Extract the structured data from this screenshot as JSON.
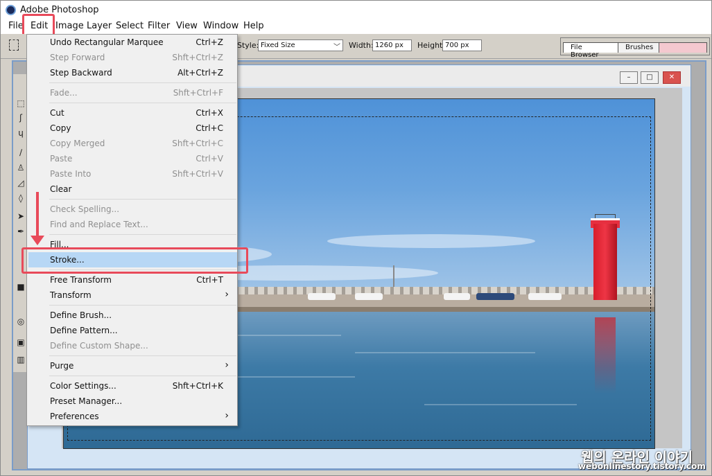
{
  "app": {
    "title": "Adobe Photoshop"
  },
  "menubar": [
    "File",
    "Edit",
    "Image",
    "Layer",
    "Select",
    "Filter",
    "View",
    "Window",
    "Help"
  ],
  "options": {
    "style_label": "Style:",
    "style_value": "Fixed Size",
    "width_label": "Width:",
    "width_value": "1260 px",
    "height_label": "Height:",
    "height_value": "700 px"
  },
  "palette_tabs": [
    "File Browser",
    "Brushes"
  ],
  "edit_menu": [
    {
      "label": "Undo Rectangular Marquee",
      "shortcut": "Ctrl+Z",
      "enabled": true
    },
    {
      "label": "Step Forward",
      "shortcut": "Shft+Ctrl+Z",
      "enabled": false
    },
    {
      "label": "Step Backward",
      "shortcut": "Alt+Ctrl+Z",
      "enabled": true
    },
    {
      "label": "Fade...",
      "shortcut": "Shft+Ctrl+F",
      "enabled": false
    },
    {
      "label": "Cut",
      "shortcut": "Ctrl+X",
      "enabled": true
    },
    {
      "label": "Copy",
      "shortcut": "Ctrl+C",
      "enabled": true
    },
    {
      "label": "Copy Merged",
      "shortcut": "Shft+Ctrl+C",
      "enabled": false
    },
    {
      "label": "Paste",
      "shortcut": "Ctrl+V",
      "enabled": false
    },
    {
      "label": "Paste Into",
      "shortcut": "Shft+Ctrl+V",
      "enabled": false
    },
    {
      "label": "Clear",
      "shortcut": "",
      "enabled": true
    },
    {
      "label": "Check Spelling...",
      "shortcut": "",
      "enabled": false
    },
    {
      "label": "Find and Replace Text...",
      "shortcut": "",
      "enabled": false
    },
    {
      "label": "Fill...",
      "shortcut": "",
      "enabled": true
    },
    {
      "label": "Stroke...",
      "shortcut": "",
      "enabled": true
    },
    {
      "label": "Free Transform",
      "shortcut": "Ctrl+T",
      "enabled": true
    },
    {
      "label": "Transform",
      "shortcut": "",
      "enabled": true,
      "submenu": true
    },
    {
      "label": "Define Brush...",
      "shortcut": "",
      "enabled": true
    },
    {
      "label": "Define Pattern...",
      "shortcut": "",
      "enabled": true
    },
    {
      "label": "Define Custom Shape...",
      "shortcut": "",
      "enabled": false
    },
    {
      "label": "Purge",
      "shortcut": "",
      "enabled": true,
      "submenu": true
    },
    {
      "label": "Color Settings...",
      "shortcut": "Shft+Ctrl+K",
      "enabled": true
    },
    {
      "label": "Preset Manager...",
      "shortcut": "",
      "enabled": true
    },
    {
      "label": "Preferences",
      "shortcut": "",
      "enabled": true,
      "submenu": true
    }
  ],
  "highlighted_item": "Stroke...",
  "watermark": {
    "line1": "웹의 온라인 이야기",
    "line2": "webonlinestory.tistory.com"
  },
  "colors": {
    "highlight": "#b7d7f5",
    "annotation": "#e84a5a",
    "disabled": "#8f8f8f"
  },
  "icons": {
    "submenu": "›",
    "minimize": "–",
    "maximize": "□",
    "close": "✕"
  }
}
